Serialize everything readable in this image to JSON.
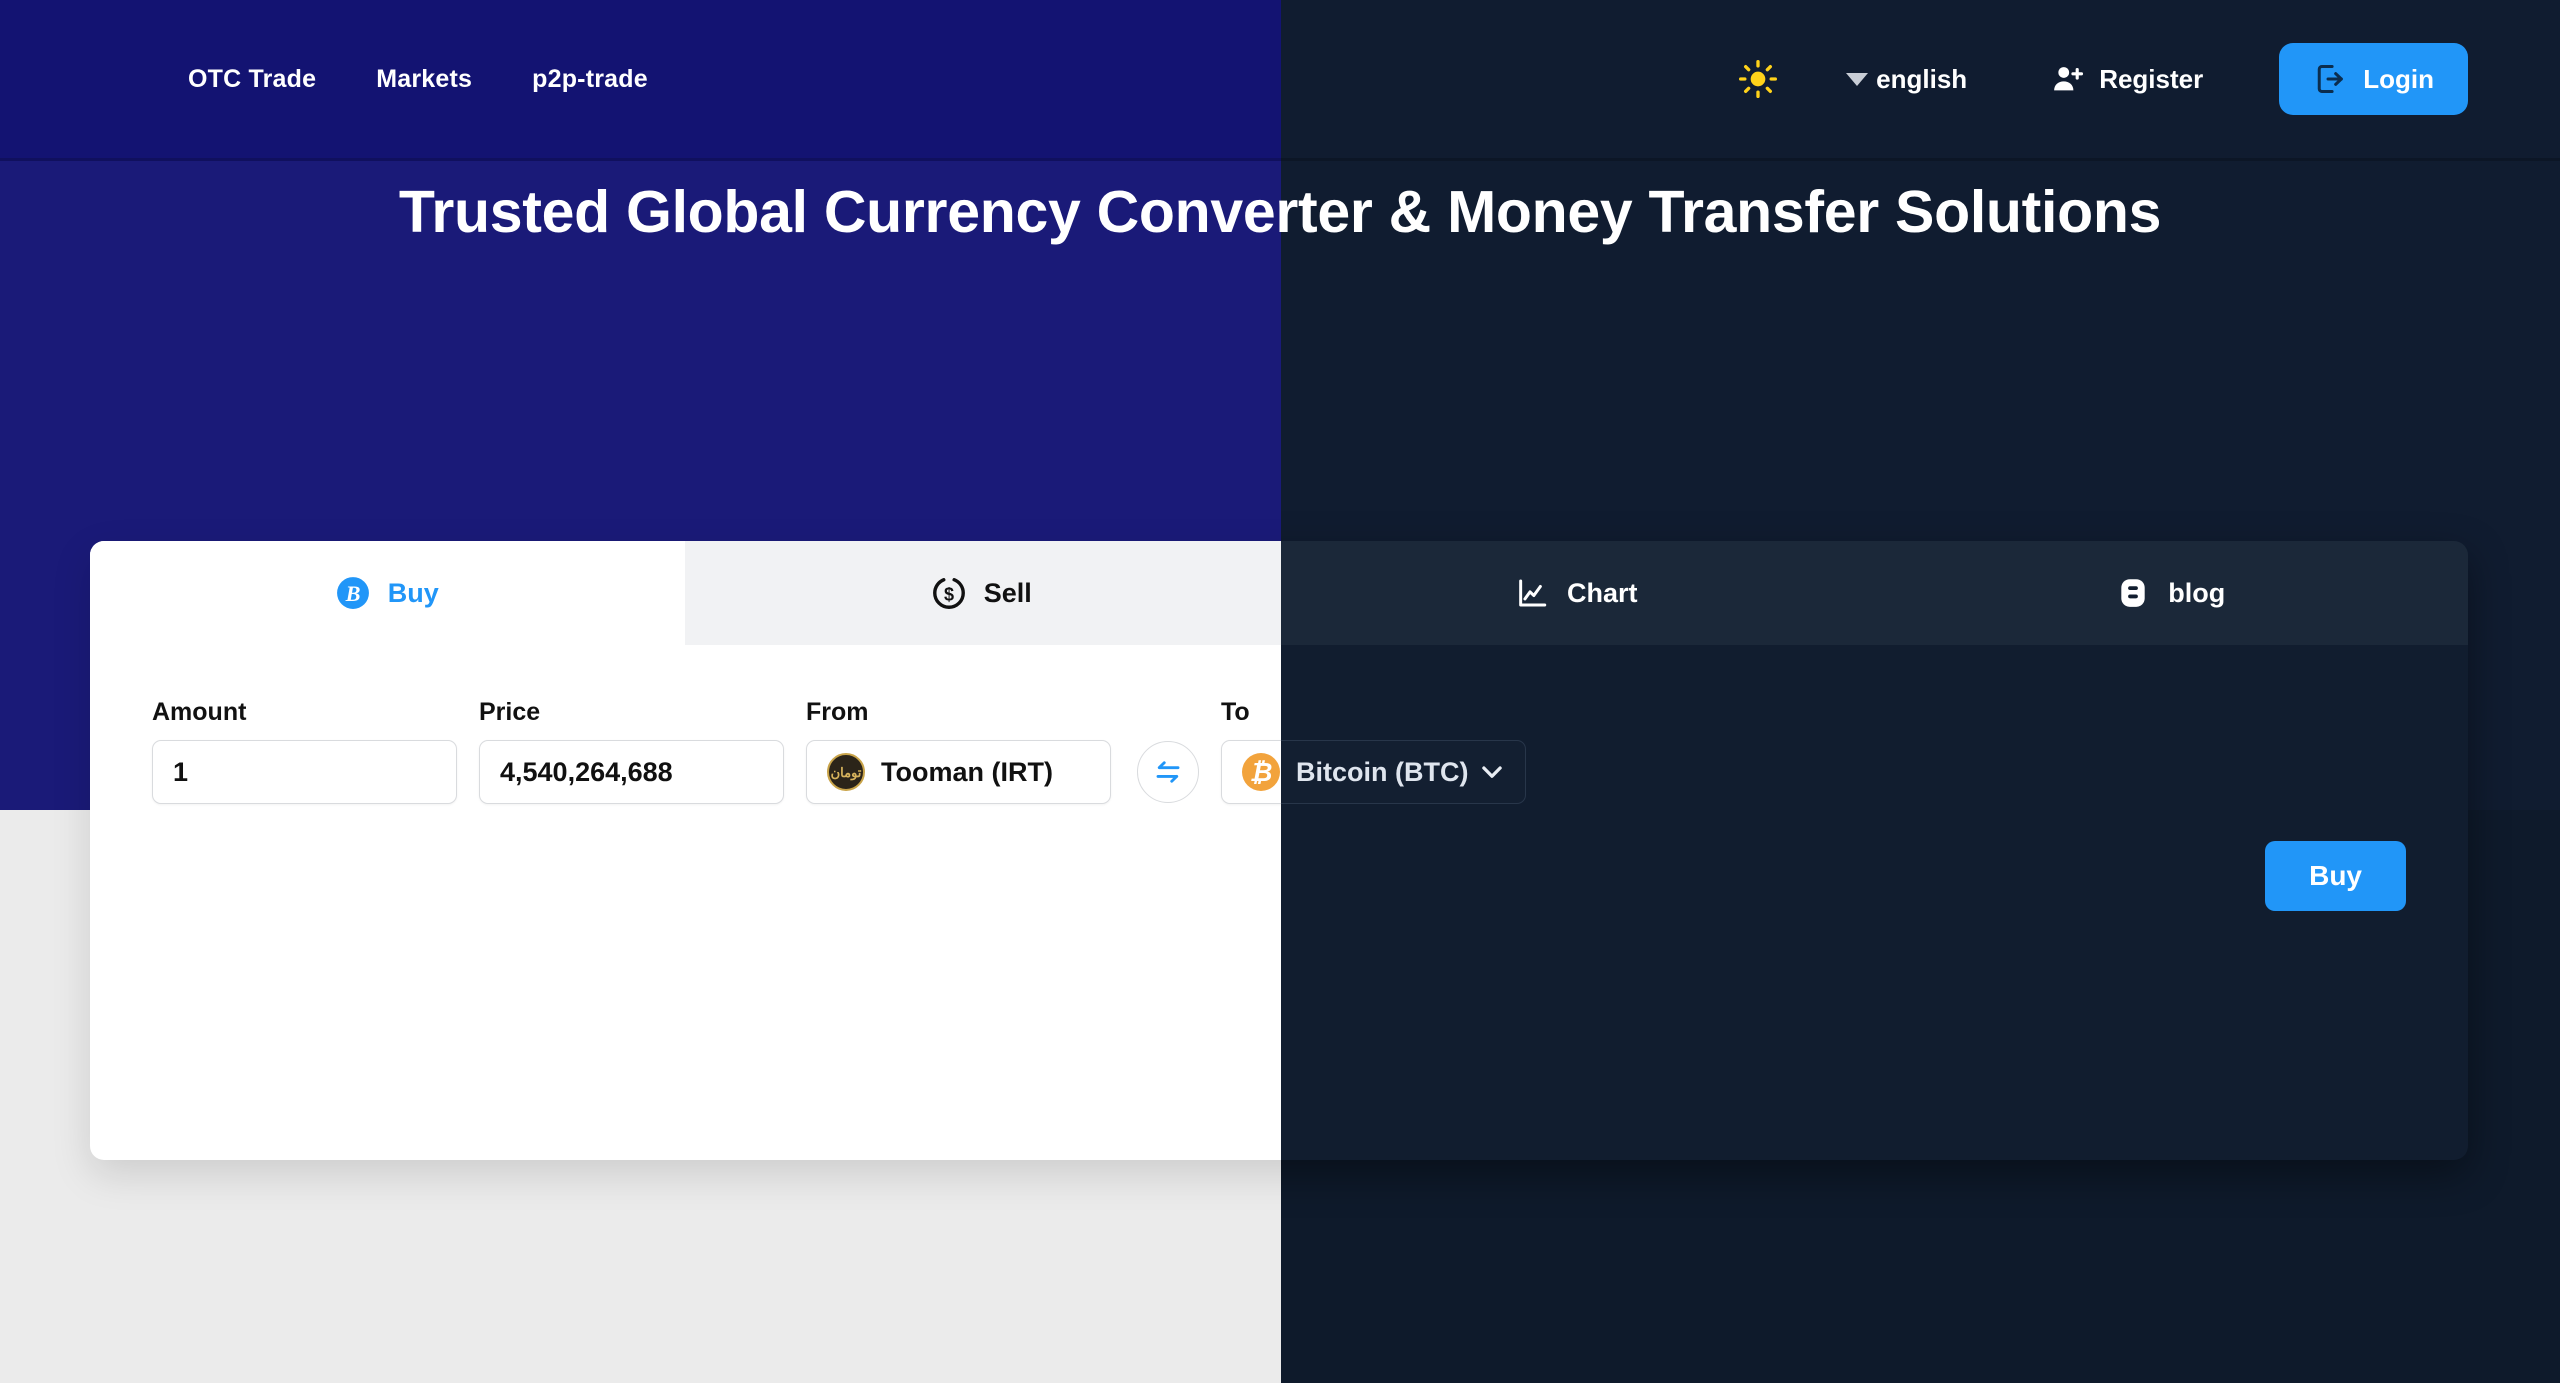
{
  "header": {
    "nav": [
      {
        "label": "OTC Trade",
        "name": "nav-otc-trade"
      },
      {
        "label": "Markets",
        "name": "nav-markets"
      },
      {
        "label": "p2p-trade",
        "name": "nav-p2p-trade"
      }
    ],
    "theme_toggle_icon": "sun-icon",
    "language": {
      "label": "english",
      "caret_icon": "caret-down-icon"
    },
    "register": {
      "label": "Register",
      "icon": "user-plus-icon"
    },
    "login": {
      "label": "Login",
      "icon": "logout-arrow-icon"
    },
    "accent_color": "#2196f8",
    "bg_color_light": "#131372",
    "bg_color_dark": "#101c30"
  },
  "hero": {
    "title": "Trusted Global Currency Converter & Money Transfer Solutions",
    "bg_color_light": "#1a1a78",
    "bg_color_dark": "#101c30"
  },
  "converter": {
    "tabs": [
      {
        "label": "Buy",
        "icon": "bitcoin-circle-icon",
        "active": true,
        "name": "tab-buy"
      },
      {
        "label": "Sell",
        "icon": "dollar-circle-icon",
        "active": false,
        "name": "tab-sell"
      },
      {
        "label": "Chart",
        "icon": "line-chart-icon",
        "active": false,
        "name": "tab-chart"
      },
      {
        "label": "blog",
        "icon": "blogger-icon",
        "active": false,
        "name": "tab-blog"
      }
    ],
    "fields": {
      "amount": {
        "label": "Amount",
        "value": "1",
        "placeholder": "Amount"
      },
      "price": {
        "label": "Price",
        "value": "4,540,264,688",
        "placeholder": "Price"
      },
      "from": {
        "label": "From",
        "value": "Tooman (IRT)",
        "coin_icon": "toman-coin-icon",
        "coin_text": "تومان"
      },
      "to": {
        "label": "To",
        "value": "Bitcoin (BTC)",
        "coin_icon": "bitcoin-coin-icon",
        "coin_symbol": "₿",
        "chevron_icon": "chevron-down-icon"
      }
    },
    "swap": {
      "icon": "swap-arrows-icon",
      "name": "swap-currencies-button"
    },
    "submit": {
      "label": "Buy",
      "color": "#2196f8"
    }
  }
}
